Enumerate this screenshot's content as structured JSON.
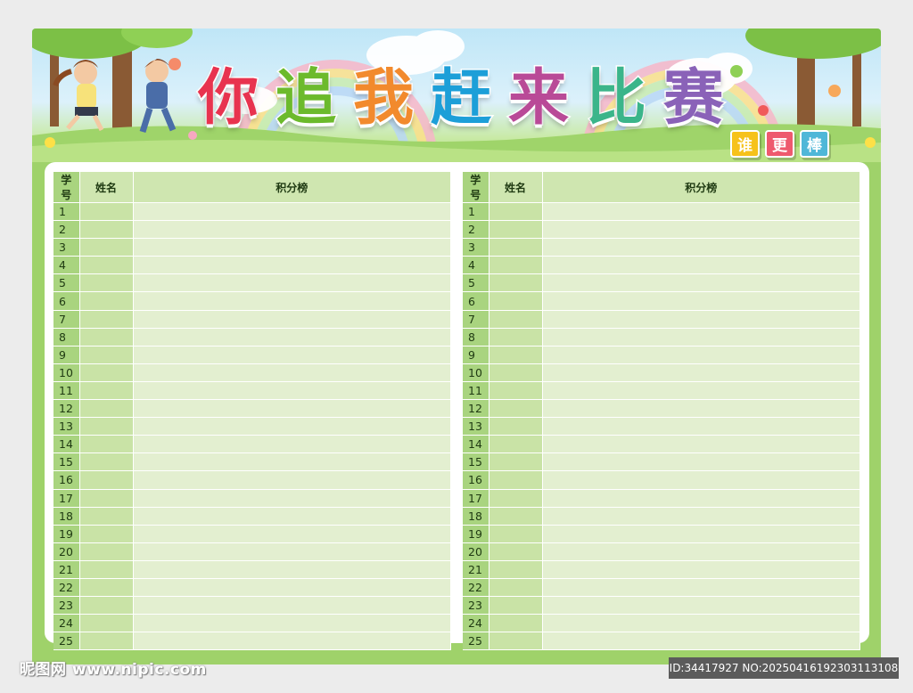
{
  "title": [
    "你",
    "追",
    "我",
    "赶",
    "来",
    "比",
    "赛"
  ],
  "title_colors": [
    "#e8334f",
    "#6cba2c",
    "#f28a2d",
    "#1d9fd8",
    "#b94a97",
    "#3bb58a",
    "#8a62b8"
  ],
  "badges": [
    {
      "text": "谁",
      "color": "#f6c21b"
    },
    {
      "text": "更",
      "color": "#ee5a6e"
    },
    {
      "text": "棒",
      "color": "#4fb7d8"
    }
  ],
  "table": {
    "headers": {
      "no": "学号",
      "name": "姓名",
      "score": "积分榜"
    },
    "rows": [
      "1",
      "2",
      "3",
      "4",
      "5",
      "6",
      "7",
      "8",
      "9",
      "10",
      "11",
      "12",
      "13",
      "14",
      "15",
      "16",
      "17",
      "18",
      "19",
      "20",
      "21",
      "22",
      "23",
      "24",
      "25"
    ]
  },
  "watermark": {
    "left": "昵图网 www.nipic.com",
    "right": "ID:34417927 NO:20250416192303113108"
  },
  "icons": [
    "rainbow-icon",
    "tree-icon",
    "children-running-illustration",
    "flower-icon",
    "cloud-icon"
  ]
}
